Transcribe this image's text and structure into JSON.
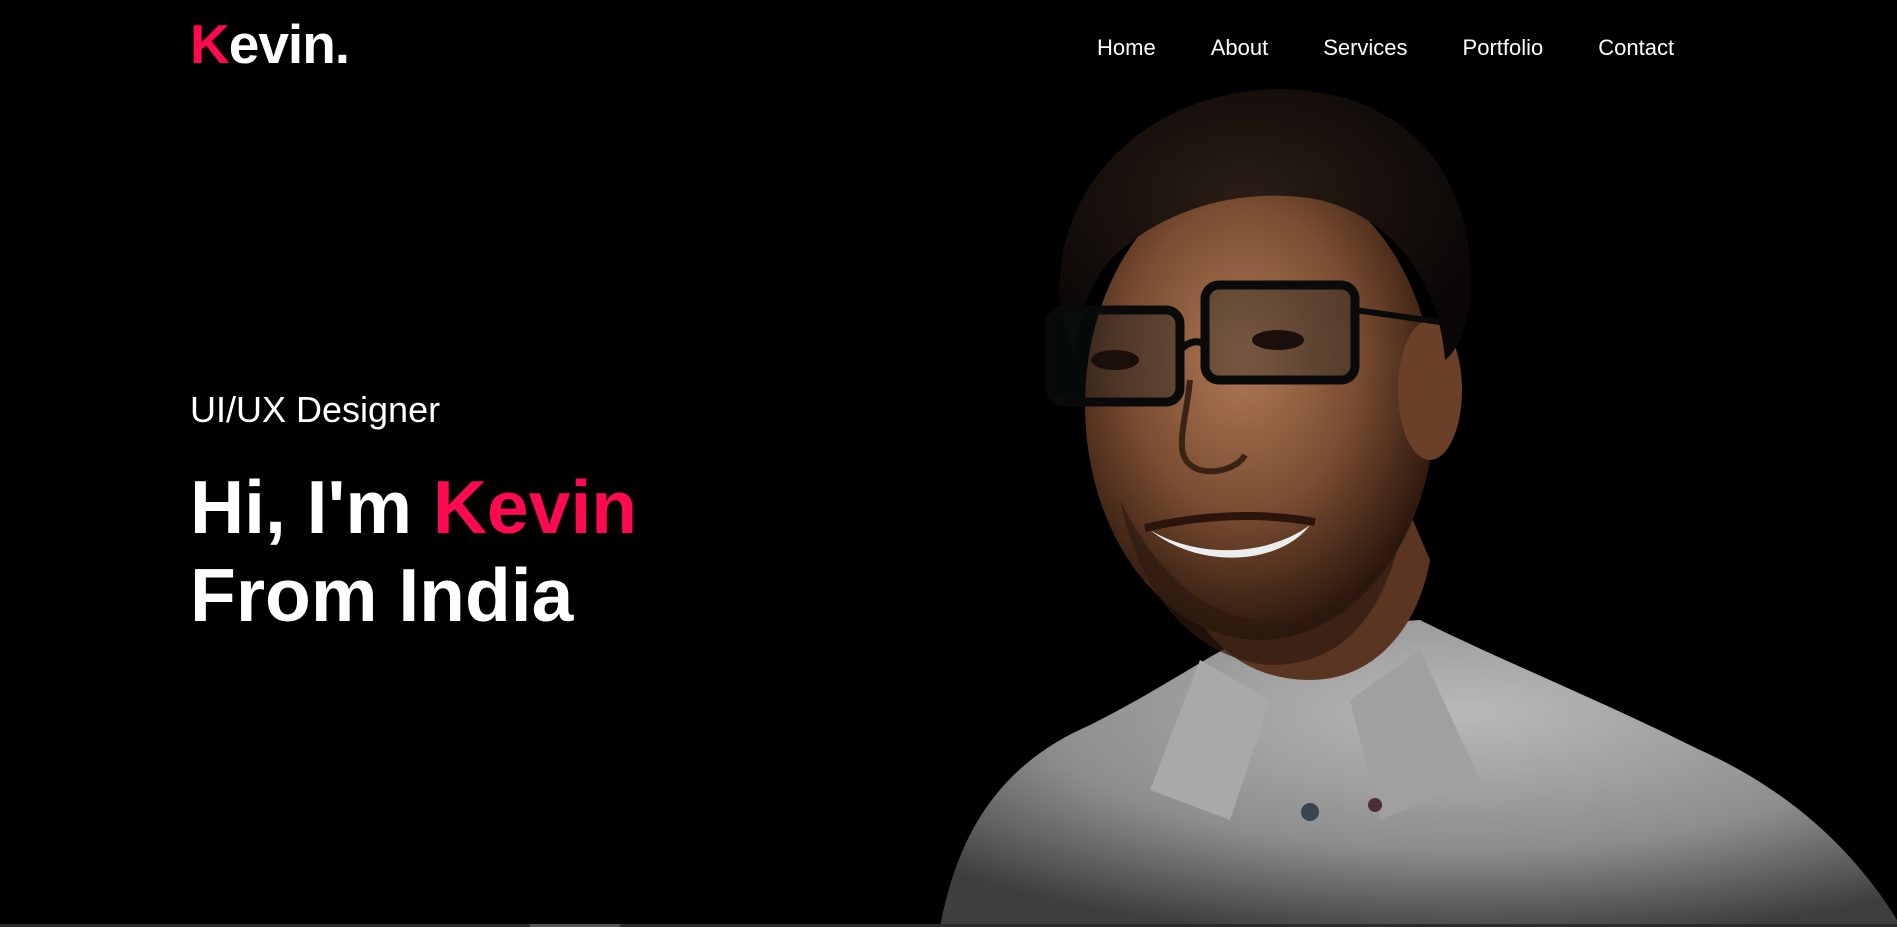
{
  "brand": {
    "logo_initial": "K",
    "logo_rest": "evin.",
    "accent_color": "#ff0a50"
  },
  "nav": {
    "items": [
      {
        "label": "Home"
      },
      {
        "label": "About"
      },
      {
        "label": "Services"
      },
      {
        "label": "Portfolio"
      },
      {
        "label": "Contact"
      }
    ]
  },
  "hero": {
    "subtitle": "UI/UX Designer",
    "title_prefix": "Hi, I'm ",
    "title_name": "Kevin",
    "title_line2": "From India"
  },
  "portrait": {
    "icon": "person-photo"
  }
}
